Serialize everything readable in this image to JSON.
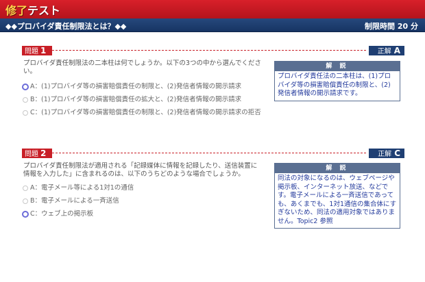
{
  "app": {
    "title_accent": "修了",
    "title_rest": "テスト"
  },
  "subbar": {
    "title": "◆◆プロバイダ責任制限法とは？◆◆",
    "time_limit": "制限時間 20 分"
  },
  "questions": [
    {
      "label": "問題",
      "number": "1",
      "answer_label": "正解",
      "answer": "A",
      "text": "プロバイダ責任制限法の二本柱は何でしょうか。以下の3つの中から選んでください。",
      "options": [
        {
          "text": "A：(1)プロバイダ等の損害賠償責任の制限と、(2)発信者情報の開示請求",
          "selected": true
        },
        {
          "text": "B：(1)プロバイダ等の損害賠償責任の拡大と、(2)発信者情報の開示請求",
          "selected": false
        },
        {
          "text": "C：(1)プロバイダ等の損害賠償責任の制限と、(2)発信者情報の開示請求の拒否",
          "selected": false
        }
      ],
      "explanation_title": "解 説",
      "explanation": "プロバイダ責任法の二本柱は、(1)プロバイダ等の損害賠償責任の制限と、(2)発信者情報の開示請求です。"
    },
    {
      "label": "問題",
      "number": "2",
      "answer_label": "正解",
      "answer": "C",
      "text": "プロバイダ責任制限法が適用される「記録媒体に情報を記録したり、送信装置に情報を入力した」に含まれるのは、以下のうちどのような場合でしょうか。",
      "options": [
        {
          "text": "A：電子メール等による1対1の通信",
          "selected": false
        },
        {
          "text": "B：電子メールによる一斉送信",
          "selected": false
        },
        {
          "text": "C：ウェブ上の掲示板",
          "selected": true
        }
      ],
      "explanation_title": "解 説",
      "explanation": "同法の対象になるのは、ウェブページや掲示板、インターネット放送、などです。電子メールによる一斉送信であっても、あくまでも、1対1通信の集合体にすぎないため、同法の適用対象ではありません。Topic2 参照"
    }
  ]
}
